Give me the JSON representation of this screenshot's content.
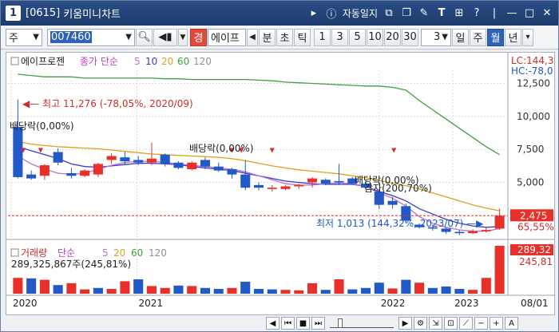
{
  "window": {
    "number": "1",
    "code": "[0615]",
    "title": "키움미니차트",
    "auto_lock": "자동일지"
  },
  "toolbar": {
    "market": "주",
    "stock_code": "007460",
    "badge": "경",
    "stock_name": "에이프",
    "period_units": [
      "분",
      "초",
      "틱"
    ],
    "intervals": [
      "1",
      "3",
      "5",
      "10",
      "20",
      "30"
    ],
    "count_value": "3",
    "periods": [
      "일",
      "주",
      "월",
      "년"
    ],
    "selected_period": "월"
  },
  "chart_header": {
    "stock": "에이프로젠",
    "ma_label": "종가 단순",
    "ma_periods": [
      "5",
      "10",
      "20",
      "60",
      "120"
    ],
    "lc": "LC:144,3",
    "hc": "HC:-78,0"
  },
  "annotations": {
    "high": "최고 11,276 (-78,05%, 2020/09)",
    "low": "최저 1,013 (144,32%, 2023/07)",
    "div1": "배당락(0,00%)",
    "div2": "배당락(0,00%)",
    "div3": "배당락(0,00%)",
    "capred": "감자(200,70%)"
  },
  "price_axis": {
    "ticks": [
      "12,500",
      "10,000",
      "7,500",
      "5,000"
    ],
    "current": "2,475",
    "current_pct": "65,55%"
  },
  "volume_header": {
    "label": "거래량",
    "ma_label": "단순",
    "ma_periods": [
      "5",
      "20",
      "60",
      "120"
    ],
    "last_value": "289,325,867주(245,81%)",
    "axis_current": "289,32",
    "axis_pct": "245,81"
  },
  "date_axis": [
    "2020",
    "2021",
    "2022",
    "2023"
  ],
  "date_end": "08/01",
  "colors": {
    "up": "#e8302a",
    "down": "#2159c7",
    "ma5": "#c070d0",
    "ma10": "#3a3ad0",
    "ma20": "#e0a020",
    "ma60": "#40a040",
    "ma120": "#909090"
  },
  "chart_data": {
    "type": "candlestick",
    "ylim": [
      800,
      13500
    ],
    "candles": [
      {
        "o": 9200,
        "h": 11276,
        "l": 5300,
        "c": 5400
      },
      {
        "o": 5600,
        "h": 5900,
        "l": 5200,
        "c": 5300
      },
      {
        "o": 5500,
        "h": 6400,
        "l": 5200,
        "c": 6300
      },
      {
        "o": 7300,
        "h": 7600,
        "l": 6300,
        "c": 6500
      },
      {
        "o": 5700,
        "h": 6100,
        "l": 5300,
        "c": 5500
      },
      {
        "o": 5500,
        "h": 6000,
        "l": 5400,
        "c": 5900
      },
      {
        "o": 5600,
        "h": 6500,
        "l": 5400,
        "c": 6400
      },
      {
        "o": 6700,
        "h": 7200,
        "l": 6400,
        "c": 7000
      },
      {
        "o": 6900,
        "h": 7300,
        "l": 6400,
        "c": 6600
      },
      {
        "o": 6700,
        "h": 7000,
        "l": 6300,
        "c": 6500
      },
      {
        "o": 6500,
        "h": 8000,
        "l": 6300,
        "c": 6800
      },
      {
        "o": 7100,
        "h": 7200,
        "l": 6200,
        "c": 6400
      },
      {
        "o": 6500,
        "h": 6600,
        "l": 6000,
        "c": 6100
      },
      {
        "o": 6000,
        "h": 6600,
        "l": 5900,
        "c": 6500
      },
      {
        "o": 6700,
        "h": 6900,
        "l": 6000,
        "c": 6200
      },
      {
        "o": 6200,
        "h": 6500,
        "l": 5800,
        "c": 5900
      },
      {
        "o": 6000,
        "h": 6100,
        "l": 5300,
        "c": 5600
      },
      {
        "o": 5600,
        "h": 6700,
        "l": 4400,
        "c": 4600
      },
      {
        "o": 4800,
        "h": 5000,
        "l": 4400,
        "c": 4600
      },
      {
        "o": 4500,
        "h": 4800,
        "l": 4300,
        "c": 4600
      },
      {
        "o": 4500,
        "h": 4800,
        "l": 4400,
        "c": 4700
      },
      {
        "o": 4700,
        "h": 4900,
        "l": 4500,
        "c": 4800
      },
      {
        "o": 5000,
        "h": 5400,
        "l": 4600,
        "c": 5300
      },
      {
        "o": 5200,
        "h": 5300,
        "l": 4800,
        "c": 4900
      },
      {
        "o": 5100,
        "h": 6400,
        "l": 4800,
        "c": 5000
      },
      {
        "o": 5300,
        "h": 5400,
        "l": 4800,
        "c": 4900
      },
      {
        "o": 4900,
        "h": 5200,
        "l": 4500,
        "c": 4600
      },
      {
        "o": 4300,
        "h": 4500,
        "l": 3000,
        "c": 3300
      },
      {
        "o": 3600,
        "h": 3900,
        "l": 3000,
        "c": 3300
      },
      {
        "o": 3200,
        "h": 3400,
        "l": 1900,
        "c": 2100
      },
      {
        "o": 1800,
        "h": 1900,
        "l": 1500,
        "c": 1600
      },
      {
        "o": 1600,
        "h": 1800,
        "l": 1350,
        "c": 1500
      },
      {
        "o": 1500,
        "h": 1600,
        "l": 1100,
        "c": 1250
      },
      {
        "o": 1250,
        "h": 1400,
        "l": 1013,
        "c": 1150
      },
      {
        "o": 1150,
        "h": 1450,
        "l": 1100,
        "c": 1300
      },
      {
        "o": 1300,
        "h": 1550,
        "l": 1200,
        "c": 1400
      },
      {
        "o": 1500,
        "h": 3000,
        "l": 1400,
        "c": 2475
      }
    ],
    "ma120": [
      13200,
      13100,
      13000,
      13000,
      13000,
      12900,
      12900,
      12900,
      12900,
      12900,
      12900,
      12850,
      12850,
      12800,
      12800,
      12800,
      12800,
      12800,
      12750,
      12700,
      12600,
      12550,
      12500,
      12450,
      12400,
      12350,
      12300,
      12300,
      12200,
      12000,
      11200,
      10500,
      9800,
      9100,
      8400,
      7700,
      7100
    ],
    "ma20": [
      8100,
      7900,
      7800,
      7700,
      7650,
      7600,
      7550,
      7450,
      7350,
      7250,
      7150,
      7100,
      7050,
      7000,
      6950,
      6900,
      6800,
      6650,
      6450,
      6250,
      6100,
      5950,
      5850,
      5750,
      5650,
      5500,
      5350,
      5150,
      4950,
      4750,
      4500,
      4200,
      3900,
      3600,
      3300,
      3050,
      2850
    ],
    "ma10": [
      7700,
      7400,
      7100,
      6800,
      6400,
      6200,
      6150,
      6250,
      6350,
      6450,
      6450,
      6400,
      6350,
      6200,
      6100,
      6000,
      5900,
      5700,
      5500,
      5300,
      5100,
      5000,
      4900,
      4850,
      4850,
      4850,
      4700,
      4300,
      4000,
      3600,
      3000,
      2600,
      2200,
      1900,
      1700,
      1600,
      1650
    ],
    "ma5": [
      7000,
      6400,
      6000,
      5700,
      5600,
      5700,
      6000,
      6300,
      6500,
      6600,
      6600,
      6500,
      6400,
      6300,
      6200,
      6100,
      6000,
      5800,
      5500,
      5200,
      4900,
      4800,
      4800,
      4900,
      4950,
      4900,
      4700,
      4200,
      3800,
      3200,
      2400,
      1900,
      1600,
      1400,
      1300,
      1300,
      1500
    ],
    "volume": [
      {
        "v": 0.33,
        "up": true
      },
      {
        "v": 0.32,
        "up": false
      },
      {
        "v": 0.29,
        "up": true
      },
      {
        "v": 0.18,
        "up": false
      },
      {
        "v": 0.22,
        "up": true
      },
      {
        "v": 0.09,
        "up": true
      },
      {
        "v": 0.12,
        "up": false
      },
      {
        "v": 0.1,
        "up": true
      },
      {
        "v": 0.26,
        "up": true
      },
      {
        "v": 0.3,
        "up": false
      },
      {
        "v": 0.16,
        "up": true
      },
      {
        "v": 0.12,
        "up": true
      },
      {
        "v": 0.17,
        "up": false
      },
      {
        "v": 0.16,
        "up": true
      },
      {
        "v": 0.12,
        "up": false
      },
      {
        "v": 0.1,
        "up": false
      },
      {
        "v": 0.12,
        "up": true
      },
      {
        "v": 0.25,
        "up": false
      },
      {
        "v": 0.1,
        "up": false
      },
      {
        "v": 0.09,
        "up": false
      },
      {
        "v": 0.08,
        "up": true
      },
      {
        "v": 0.07,
        "up": true
      },
      {
        "v": 0.22,
        "up": true
      },
      {
        "v": 0.08,
        "up": false
      },
      {
        "v": 0.3,
        "up": true
      },
      {
        "v": 0.09,
        "up": false
      },
      {
        "v": 0.12,
        "up": false
      },
      {
        "v": 0.23,
        "up": false
      },
      {
        "v": 0.11,
        "up": true
      },
      {
        "v": 0.29,
        "up": false
      },
      {
        "v": 0.23,
        "up": true
      },
      {
        "v": 0.12,
        "up": false
      },
      {
        "v": 0.15,
        "up": false
      },
      {
        "v": 0.1,
        "up": false
      },
      {
        "v": 0.08,
        "up": true
      },
      {
        "v": 0.33,
        "up": true
      },
      {
        "v": 1.0,
        "up": true
      }
    ]
  }
}
